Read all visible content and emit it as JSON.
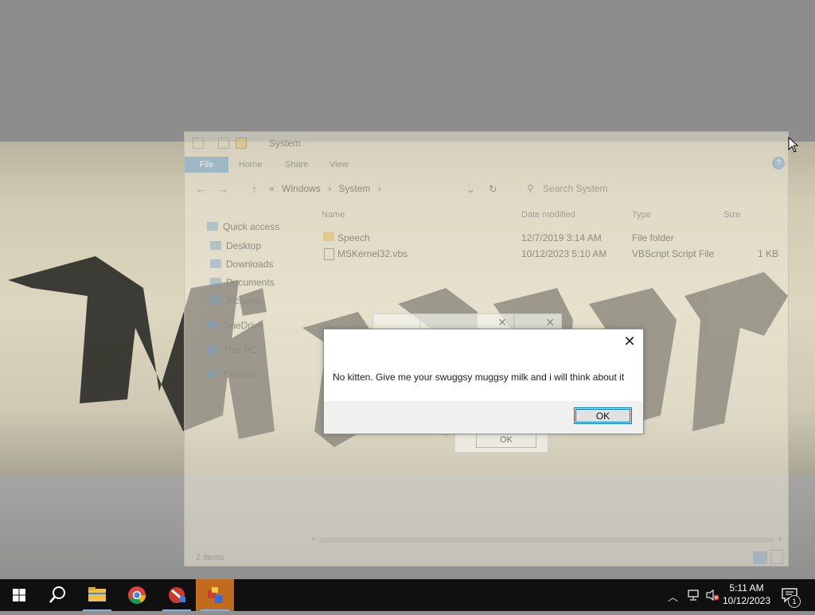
{
  "explorer": {
    "title": "System",
    "ribbon_tabs": [
      "File",
      "Home",
      "Share",
      "View"
    ],
    "help_label": "?",
    "breadcrumb": [
      "«",
      "Windows",
      "›",
      "System",
      "›"
    ],
    "search_placeholder": "Search System",
    "nav": {
      "quick_access": "Quick access",
      "desktop": "Desktop",
      "downloads": "Downloads",
      "documents": "Documents",
      "pictures": "Pictures",
      "onedrive": "OneDrive",
      "this_pc": "This PC",
      "network": "Network"
    },
    "columns": {
      "name": "Name",
      "date": "Date modified",
      "type": "Type",
      "size": "Size"
    },
    "files": [
      {
        "name": "Speech",
        "date": "12/7/2019 3:14 AM",
        "type": "File folder",
        "size": ""
      },
      {
        "name": "MSKernel32.vbs",
        "date": "10/12/2023 5:10 AM",
        "type": "VBScript Script File",
        "size": "1 KB"
      }
    ],
    "status": "2 items"
  },
  "ghost_dialog": {
    "ok_label": "OK"
  },
  "message_box": {
    "text": "No kitten. Give me your swuggsy muggsy milk and i will think about it",
    "ok_label": "OK",
    "close_glyph": "✕"
  },
  "taskbar": {
    "clock_time": "5:11 AM",
    "clock_date": "10/12/2023",
    "notification_count": "1"
  },
  "colors": {
    "taskbar_bg": "#101010",
    "accent": "#0078d7",
    "highlight_app": "#c26b1c"
  }
}
